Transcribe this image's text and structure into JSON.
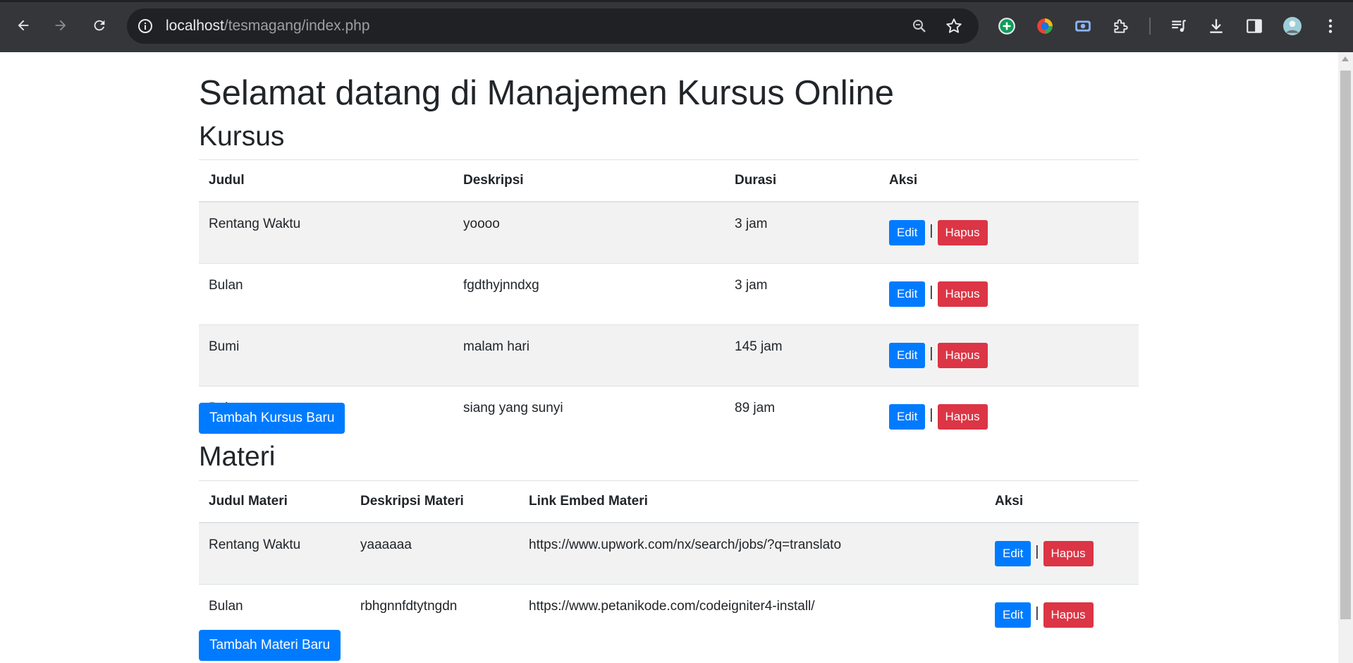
{
  "browser": {
    "url_host": "localhost",
    "url_path": "/tesmagang/index.php",
    "icons": {
      "back": "arrow-left-icon",
      "forward": "arrow-right-icon",
      "reload": "reload-icon",
      "info": "info-icon",
      "zoom": "zoom-icon",
      "bookmark": "star-icon"
    }
  },
  "page": {
    "title": "Selamat datang di Manajemen Kursus Online"
  },
  "kursus": {
    "heading": "Kursus",
    "columns": [
      "Judul",
      "Deskripsi",
      "Durasi",
      "Aksi"
    ],
    "rows": [
      {
        "judul": "Rentang Waktu",
        "deskripsi": "yoooo",
        "durasi": "3 jam"
      },
      {
        "judul": "Bulan",
        "deskripsi": "fgdthyjnndxg",
        "durasi": "3 jam"
      },
      {
        "judul": "Bumi",
        "deskripsi": "malam hari",
        "durasi": "145 jam"
      },
      {
        "judul": "Bulan",
        "deskripsi": "siang yang sunyi",
        "durasi": "89 jam"
      }
    ],
    "add_label": "Tambah Kursus Baru"
  },
  "materi": {
    "heading": "Materi",
    "columns": [
      "Judul Materi",
      "Deskripsi Materi",
      "Link Embed Materi",
      "Aksi"
    ],
    "rows": [
      {
        "judul": "Rentang Waktu",
        "deskripsi": "yaaaaaa",
        "link": "https://www.upwork.com/nx/search/jobs/?q=translato"
      },
      {
        "judul": "Bulan",
        "deskripsi": "rbhgnnfdtytngdn",
        "link": "https://www.petanikode.com/codeigniter4-install/"
      }
    ],
    "add_label": "Tambah Materi Baru"
  },
  "actions": {
    "edit_label": "Edit",
    "delete_label": "Hapus",
    "separator": "|"
  },
  "colors": {
    "primary": "#007bff",
    "danger": "#dc3545",
    "chrome_bg": "#35363a",
    "omnibox_bg": "#202124"
  }
}
